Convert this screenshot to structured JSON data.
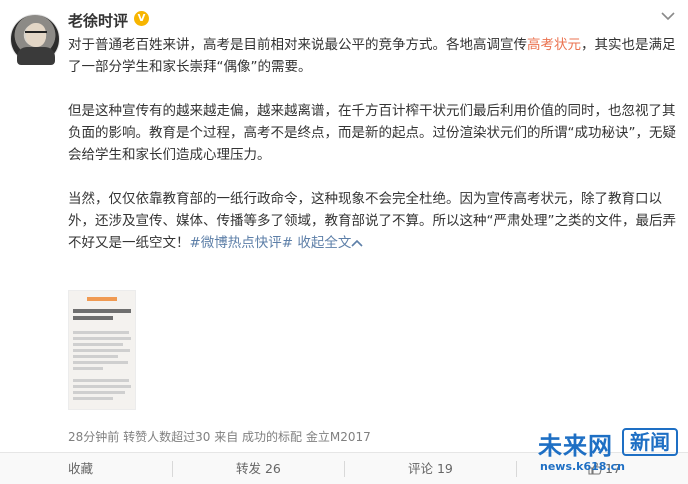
{
  "user": {
    "name": "老徐时评",
    "badge": "V"
  },
  "post": {
    "p1_before": "对于普通老百姓来讲，高考是目前相对来说最公平的竞争方式。各地高调宣传",
    "p1_link": "高考状元",
    "p1_after": "，其实也是满足了一部分学生和家长崇拜“偶像”的需要。",
    "p2": "但是这种宣传有的越来越走偏，越来越离谱，在千方百计榨干状元们最后利用价值的同时，也忽视了其负面的影响。教育是个过程，高考不是终点，而是新的起点。过份渲染状元们的所谓“成功秘诀”，无疑会给学生和家长们造成心理压力。",
    "p3": "当然，仅仅依靠教育部的一纸行政命令，这种现象不会完全杜绝。因为宣传高考状元，除了教育口以外，还涉及宣传、媒体、传播等多了领域，教育部说了不算。所以这种“严肃处理”之类的文件，最后弄不好又是一纸空文！",
    "topic": "#微博热点快评#",
    "collapse": "收起全文",
    "collapse_icon": "chevron-up-icon"
  },
  "meta": {
    "time": "28分钟前",
    "reposts_text": "转赞人数超过30",
    "source": "来自 成功的标配 金立M2017"
  },
  "actions": {
    "favorite": "收藏",
    "forward": "转发 26",
    "comment": "评论 19",
    "like": "17"
  },
  "watermark": {
    "brand": "未来网",
    "box": "新闻",
    "url": "news.k618.cn"
  }
}
